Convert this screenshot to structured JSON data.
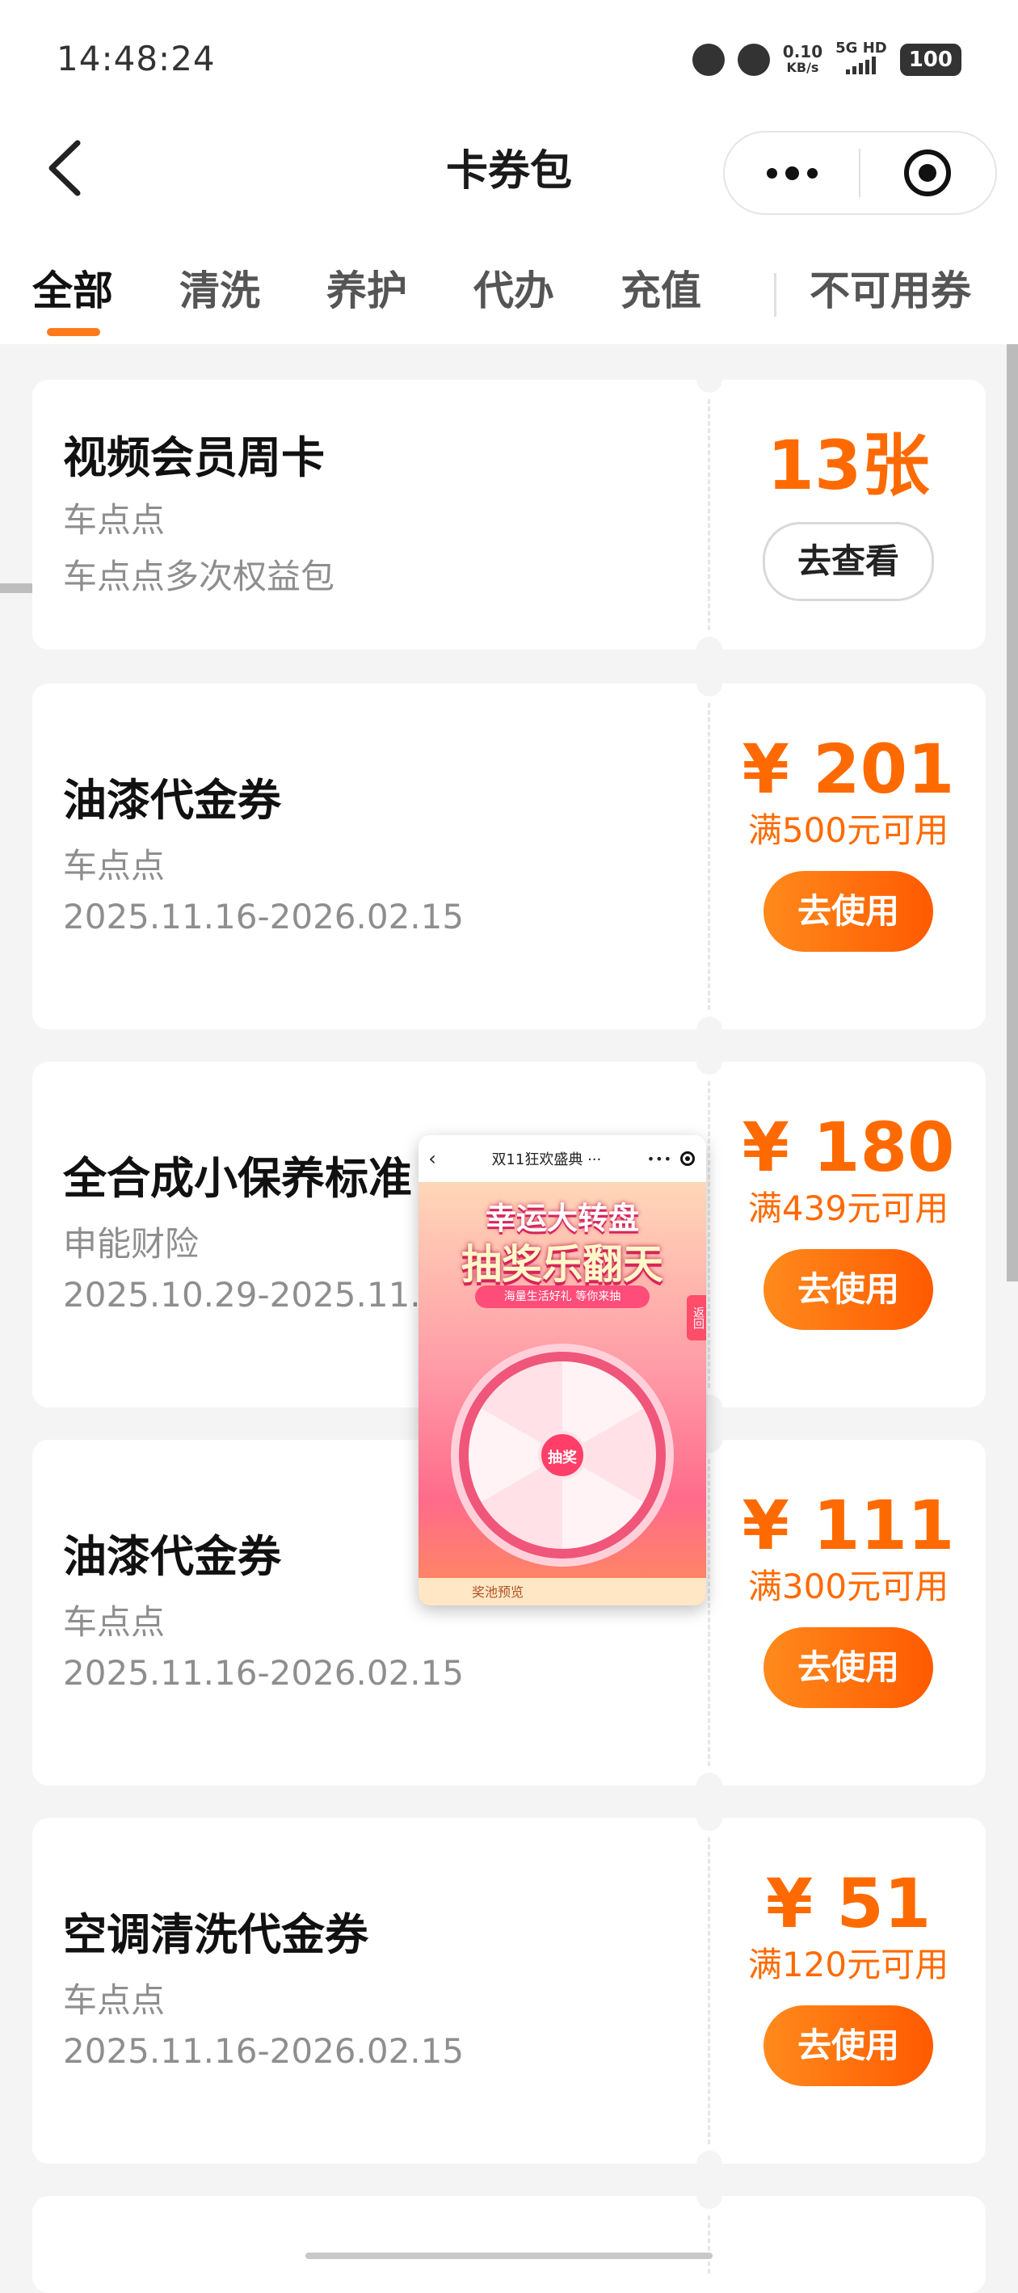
{
  "status_bar": {
    "time": "14:48:24",
    "network_speed": "0.10",
    "network_unit": "KB/s",
    "signal": "5G HD",
    "battery": "100",
    "icons": [
      "alarm-icon",
      "mute-icon",
      "signal-icon",
      "battery-icon"
    ]
  },
  "header": {
    "title": "卡券包",
    "back_icon": "back-arrow-icon",
    "menu_icon": "more-dots-icon",
    "close_icon": "target-icon"
  },
  "tabs": [
    {
      "label": "全部",
      "active": true
    },
    {
      "label": "清洗",
      "active": false
    },
    {
      "label": "养护",
      "active": false
    },
    {
      "label": "代办",
      "active": false
    },
    {
      "label": "充值",
      "active": false
    },
    {
      "label": "不可用券",
      "active": false
    }
  ],
  "coupons": [
    {
      "name": "视频会员周卡",
      "issuer": "车点点",
      "detail": "车点点多次权益包",
      "amount": "13张",
      "action": "去查看"
    },
    {
      "name": "油漆代金券",
      "issuer": "车点点",
      "detail": "2025.11.16-2026.02.15",
      "amount": "¥ 201",
      "condition": "满500元可用",
      "action": "去使用"
    },
    {
      "name": "全合成小保养标准",
      "issuer": "申能财险",
      "detail": "2025.10.29-2025.11.2",
      "amount": "¥ 180",
      "condition": "满439元可用",
      "action": "去使用"
    },
    {
      "name": "油漆代金券",
      "issuer": "车点点",
      "detail": "2025.11.16-2026.02.15",
      "amount": "¥ 111",
      "condition": "满300元可用",
      "action": "去使用"
    },
    {
      "name": "空调清洗代金券",
      "issuer": "车点点",
      "detail": "2025.11.16-2026.02.15",
      "amount": "¥ 51",
      "condition": "满120元可用",
      "action": "去使用"
    }
  ],
  "floating_window": {
    "title": "双11狂欢盛典 ···",
    "headline1": "幸运大转盘",
    "headline2": "抽奖乐翻天",
    "subline": "海量生活好礼 等你来抽",
    "side_tag": "返回",
    "wheel_center": "抽奖",
    "footer": "奖池预览"
  }
}
